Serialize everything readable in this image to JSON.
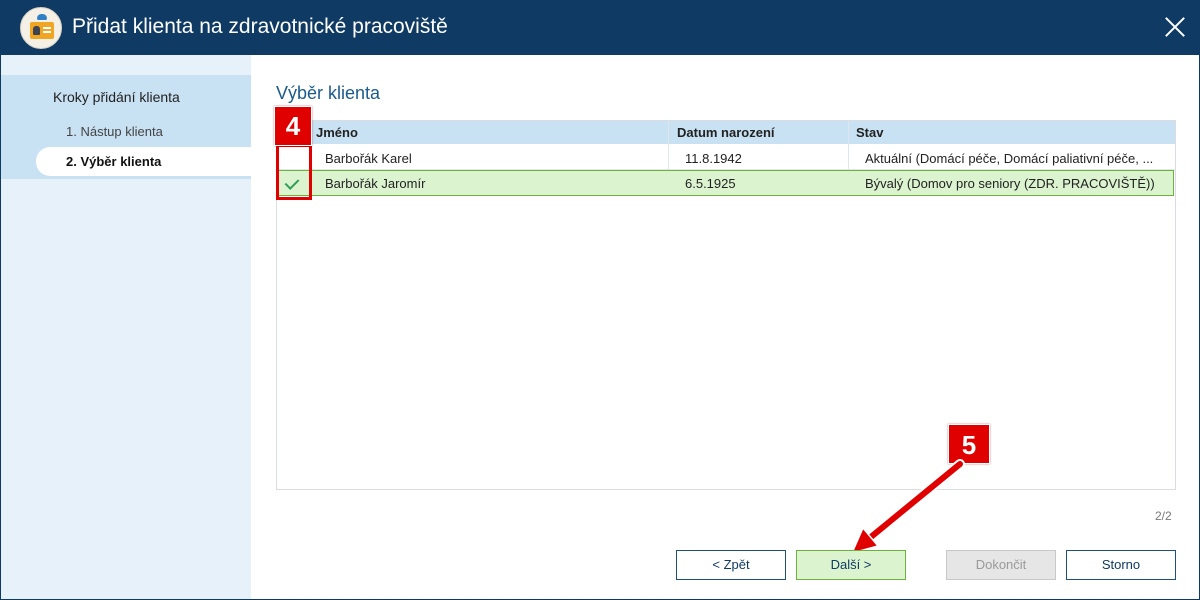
{
  "window": {
    "title": "Přidat klienta na zdravotnické pracoviště",
    "icon": "client-card-icon",
    "close_icon": "close-icon"
  },
  "sidebar": {
    "heading": "Kroky přidání klienta",
    "steps": [
      {
        "label": "1. Nástup klienta",
        "active": false
      },
      {
        "label": "2. Výběr klienta",
        "active": true
      }
    ]
  },
  "main": {
    "section_title": "Výběr klienta",
    "table": {
      "columns": [
        "Jméno",
        "Datum narození",
        "Stav"
      ],
      "rows": [
        {
          "name": "Barbořák Karel",
          "birth_date": "11.8.1942",
          "status": "Aktuální (Domácí péče, Domácí paliativní péče, ...",
          "selected": false
        },
        {
          "name": "Barbořák Jaromír",
          "birth_date": "6.5.1925",
          "status": "Bývalý (Domov pro seniory (ZDR. PRACOVIŠTĚ))",
          "selected": true
        }
      ]
    },
    "pager": "2/2"
  },
  "annotations": {
    "badge_4": "4",
    "badge_5": "5",
    "color": "#e00000"
  },
  "buttons": {
    "back": "< Zpět",
    "next": "Další >",
    "finish": "Dokončit",
    "cancel": "Storno"
  },
  "colors": {
    "titlebar": "#0f3a64",
    "sidebar_bg": "#e6f1fa",
    "table_header": "#c8e1f3",
    "selected_row": "#dcf3d0",
    "selected_border": "#6bb13b",
    "check": "#2e9f54"
  }
}
